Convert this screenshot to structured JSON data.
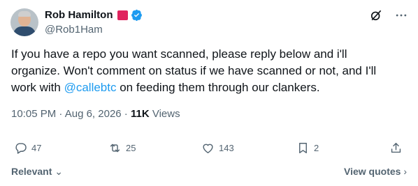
{
  "author": {
    "name": "Rob Hamilton",
    "handle": "@Rob1Ham",
    "flag_color": "#e0245e",
    "verified_color": "#1d9bf0"
  },
  "top_actions": [
    {
      "icon": "grok-icon"
    },
    {
      "icon": "more-icon",
      "label": "···"
    }
  ],
  "tweet": {
    "line1": "If you have a repo you want scanned, please reply below and i'll",
    "line2": "organize. Won't comment on status if we have scanned or not, and I'll",
    "line3_pre": "work with ",
    "mention": "@callebtc",
    "line3_post": " on feeding them through our clankers."
  },
  "meta": {
    "time": "10:05 PM",
    "sep1": " · ",
    "date": "Aug 6, 2026",
    "sep2": " · ",
    "views_count": "11K",
    "views_label": " Views"
  },
  "actions": {
    "replies": "47",
    "reposts": "25",
    "likes": "143",
    "bookmarks": "2"
  },
  "footer": {
    "sort_label": "Relevant",
    "quotes_label": "View quotes"
  },
  "colors": {
    "text": "#0f1419",
    "secondary": "#536471",
    "accent": "#1d9bf0"
  }
}
